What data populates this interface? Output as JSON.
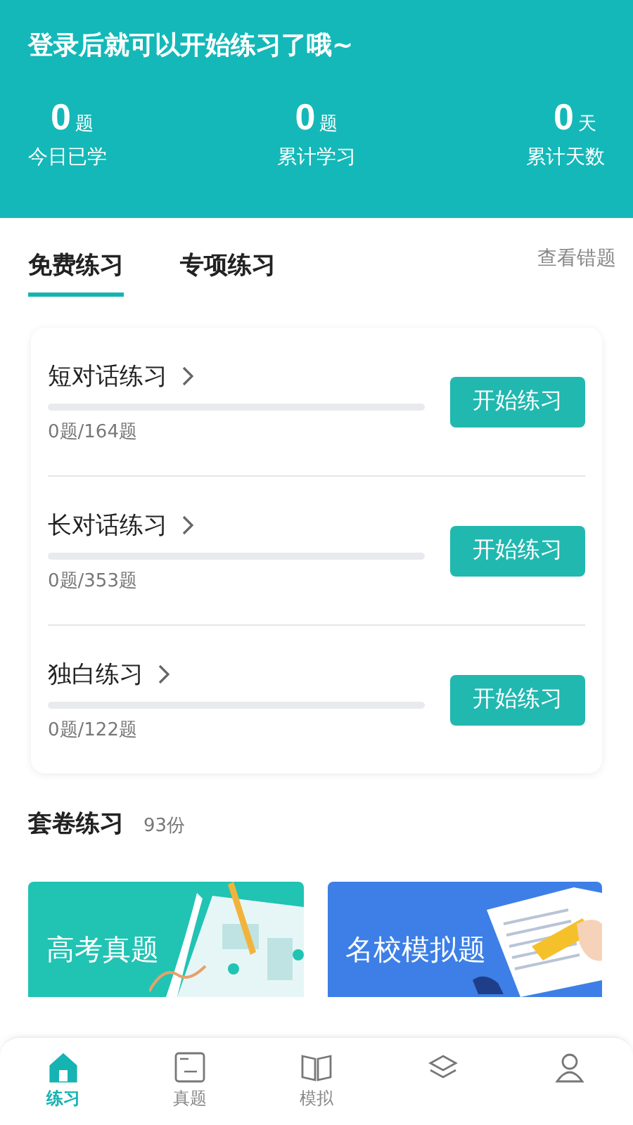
{
  "header": {
    "title": "登录后就可以开始练习了哦~",
    "stats": [
      {
        "value": "0",
        "unit": "题",
        "label": "今日已学"
      },
      {
        "value": "0",
        "unit": "题",
        "label": "累计学习"
      },
      {
        "value": "0",
        "unit": "天",
        "label": "累计天数"
      }
    ]
  },
  "tabs": [
    {
      "label": "免费练习",
      "selected": true
    },
    {
      "label": "专项练习",
      "selected": false
    }
  ],
  "wrong_link": "查看错题",
  "practice_items": [
    {
      "title": "短对话练习",
      "level": 0,
      "count": "0题/164题",
      "button": "开始练习"
    },
    {
      "title": "长对话练习",
      "level": 0,
      "count": "0题/353题",
      "button": "开始练习"
    },
    {
      "title": "独白练习",
      "level": 0,
      "count": "0题/122题",
      "button": "开始练习"
    }
  ],
  "paper_section": {
    "title": "套卷练习",
    "count": "93份",
    "cards": [
      {
        "label": "高考真题",
        "color": "#21c3b3",
        "kind": "scroll"
      },
      {
        "label": "名校模拟题",
        "color": "#3d7fe6",
        "kind": "book"
      }
    ]
  },
  "bottom_nav": [
    {
      "label": "练习",
      "kind": "home",
      "selected": true
    },
    {
      "label": "真题",
      "kind": "paper",
      "selected": false
    },
    {
      "label": "模拟",
      "kind": "book",
      "selected": false
    },
    {
      "kind": "layers",
      "selected": false
    },
    {
      "kind": "person",
      "selected": false
    }
  ]
}
